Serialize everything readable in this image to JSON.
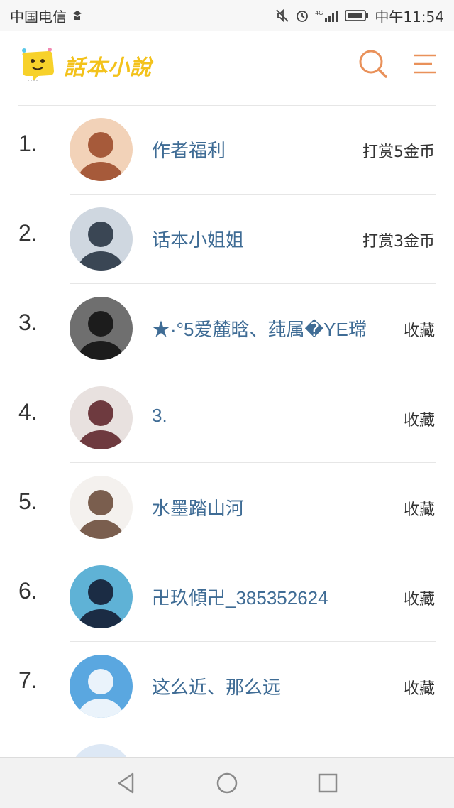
{
  "status_bar": {
    "carrier": "中国电信",
    "network": "4G",
    "time": "中午11:54"
  },
  "header": {
    "logo_text": "話本小說",
    "icons": [
      "search-icon",
      "menu-icon"
    ]
  },
  "colors": {
    "accent": "#e9915a",
    "link": "#3f6c95",
    "logo": "#f3c21b"
  },
  "ranking": [
    {
      "rank": "1.",
      "name": "作者福利",
      "action": "打赏5金币",
      "avatar_colors": [
        "#f2d2b8",
        "#a65a3a"
      ]
    },
    {
      "rank": "2.",
      "name": "话本小姐姐",
      "action": "打赏3金币",
      "avatar_colors": [
        "#cfd7e0",
        "#3a4654"
      ]
    },
    {
      "rank": "3.",
      "name": "★·°5爱麓晗、莼属�YE瑺",
      "action": "收藏",
      "avatar_colors": [
        "#6f6f6f",
        "#1c1c1c"
      ]
    },
    {
      "rank": "4.",
      "name": "3.",
      "action": "收藏",
      "avatar_colors": [
        "#e8e1df",
        "#6e3a3f"
      ]
    },
    {
      "rank": "5.",
      "name": "水墨踏山河",
      "action": "收藏",
      "avatar_colors": [
        "#f4f1ee",
        "#7a5e4e"
      ]
    },
    {
      "rank": "6.",
      "name": "卍玖傾卍_385352624",
      "action": "收藏",
      "avatar_colors": [
        "#5fb2d6",
        "#1b2c44"
      ]
    },
    {
      "rank": "7.",
      "name": "这么近、那么远",
      "action": "收藏",
      "avatar_colors": [
        "#5aa7e0",
        "#eaf3fb"
      ]
    }
  ],
  "nav": {
    "icons": [
      "back-icon",
      "home-icon",
      "recents-icon"
    ]
  }
}
